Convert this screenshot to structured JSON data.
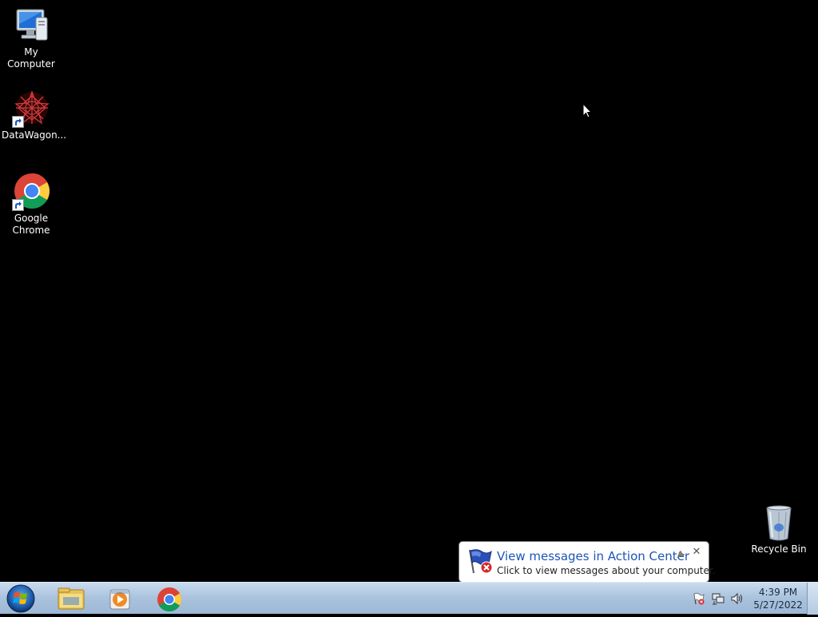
{
  "desktop": {
    "icons": [
      {
        "label": "My Computer",
        "icon": "computer-icon"
      },
      {
        "label": "DataWagon...",
        "icon": "datawagon-icon",
        "shortcut": true
      },
      {
        "label": "Google\nChrome",
        "label_line1": "Google",
        "label_line2": "Chrome",
        "icon": "chrome-icon",
        "shortcut": true
      },
      {
        "label": "Recycle Bin",
        "icon": "recycle-bin-icon"
      }
    ]
  },
  "taskbar": {
    "start_icon": "windows-start-orb-icon",
    "pinned": [
      {
        "icon": "windows-explorer-icon"
      },
      {
        "icon": "media-player-icon"
      },
      {
        "icon": "chrome-icon"
      }
    ],
    "tray": {
      "icons": [
        "action-center-flag-icon",
        "network-icon",
        "volume-icon"
      ]
    },
    "clock": {
      "time": "4:39 PM",
      "date": "5/27/2022"
    }
  },
  "balloon": {
    "title": "View messages in Action Center",
    "text": "Click to view messages about your computer.",
    "close_glyph": "✕",
    "icon": "action-center-flag-error-icon"
  },
  "colors": {
    "desktop_bg": "#000000",
    "taskbar": "#a9c2dd",
    "balloon_title": "#1c55b8"
  }
}
